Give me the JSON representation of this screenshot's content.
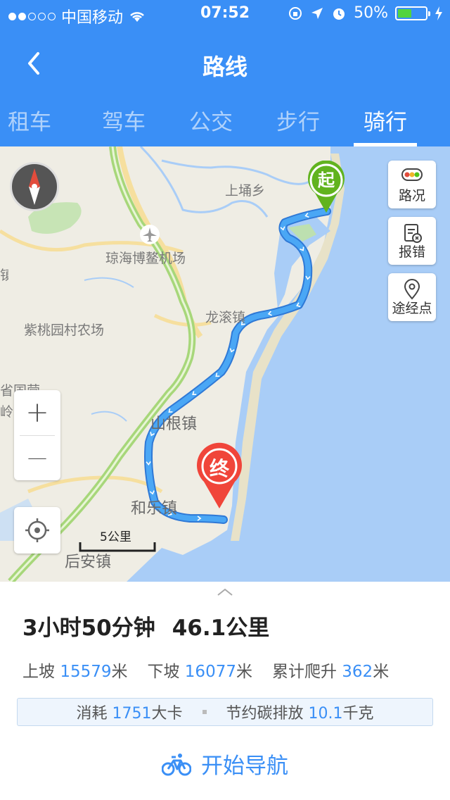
{
  "status_bar": {
    "carrier": "中国移动",
    "time": "07:52",
    "battery": "50%",
    "battery_level": 0.5,
    "signal_bars_filled": 2,
    "signal_bars_total": 5
  },
  "nav": {
    "title": "路线"
  },
  "tabs": [
    {
      "label": "租车",
      "active": false
    },
    {
      "label": "驾车",
      "active": false
    },
    {
      "label": "公交",
      "active": false
    },
    {
      "label": "步行",
      "active": false
    },
    {
      "label": "骑行",
      "active": true
    }
  ],
  "map": {
    "labels": {
      "shangyong": "上埇乡",
      "airport": "琼海博鳌机场",
      "zitao": "紫桃园村农场",
      "longgun": "龙滚镇",
      "shengen": "山根镇",
      "hele": "和乐镇",
      "houan": "后安镇",
      "partial1": "省国营",
      "partial2": "岭农",
      "partial3": "镇"
    },
    "side_buttons": {
      "traffic": "路况",
      "report": "报错",
      "waypoint": "途经点"
    },
    "zoom_in": "+",
    "zoom_out": "—",
    "scale": "5公里",
    "start_marker": "起",
    "end_marker": "终",
    "colors": {
      "route": "#4aa7f5",
      "start": "#61b31e",
      "end": "#f0453a",
      "sea": "#a9cdf7"
    }
  },
  "summary": {
    "duration": "3小时50分钟",
    "distance": "46.1公里"
  },
  "stats": {
    "uphill_label": "上坡",
    "uphill_value": "15579",
    "uphill_unit": "米",
    "downhill_label": "下坡",
    "downhill_value": "16077",
    "downhill_unit": "米",
    "climb_label": "累计爬升",
    "climb_value": "362",
    "climb_unit": "米"
  },
  "energy": {
    "calorie_label": "消耗",
    "calorie_value": "1751",
    "calorie_unit": "大卡",
    "carbon_label": "节约碳排放",
    "carbon_value": "10.1",
    "carbon_unit": "千克"
  },
  "start_nav": {
    "label": "开始导航"
  }
}
